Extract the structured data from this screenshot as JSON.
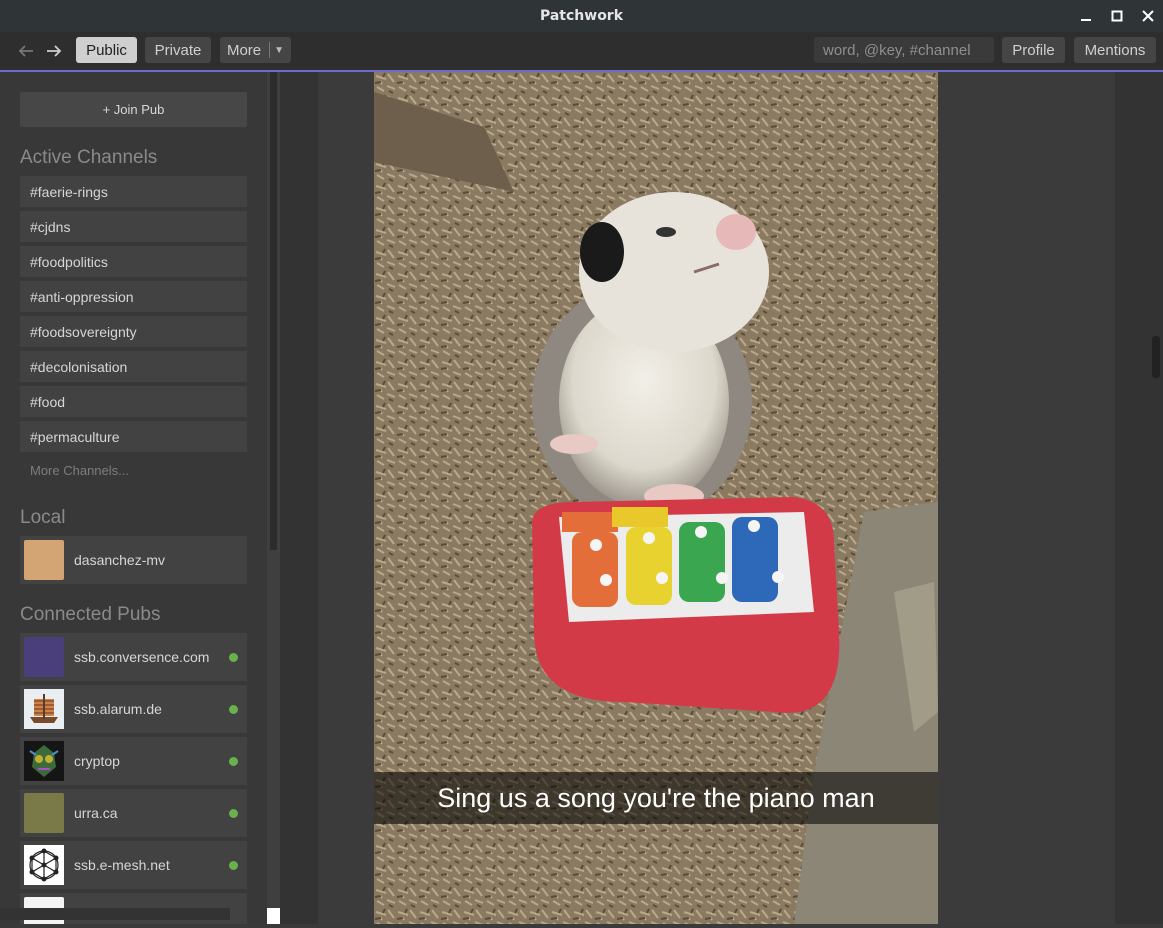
{
  "window": {
    "title": "Patchwork"
  },
  "nav": {
    "tabs": [
      "Public",
      "Private",
      "More"
    ],
    "active_tab": "Public",
    "search_placeholder": "word, @key, #channel",
    "profile_label": "Profile",
    "mentions_label": "Mentions"
  },
  "sidebar": {
    "join_pub_label": "+ Join Pub",
    "channels_heading": "Active Channels",
    "channels": [
      "#faerie-rings",
      "#cjdns",
      "#foodpolitics",
      "#anti-oppression",
      "#foodsovereignty",
      "#decolonisation",
      "#food",
      "#permaculture"
    ],
    "more_channels_label": "More Channels...",
    "local_heading": "Local",
    "local_peers": [
      {
        "name": "dasanchez-mv",
        "color": "#d4a574"
      }
    ],
    "pubs_heading": "Connected Pubs",
    "pubs": [
      {
        "name": "ssb.conversence.com",
        "color": "#4a3f7a",
        "online": true
      },
      {
        "name": "ssb.alarum.de",
        "color": "#8ab0c8",
        "online": true
      },
      {
        "name": "cryptop",
        "color": "#2a3a2a",
        "online": true
      },
      {
        "name": "urra.ca",
        "color": "#7a7a48",
        "online": true
      },
      {
        "name": "ssb.e-mesh.net",
        "color": "#ffffff",
        "online": true
      }
    ]
  },
  "post": {
    "image_caption": "Sing us a song you're the piano man"
  },
  "colors": {
    "accent": "#6f69c9",
    "online": "#6ab04c"
  }
}
